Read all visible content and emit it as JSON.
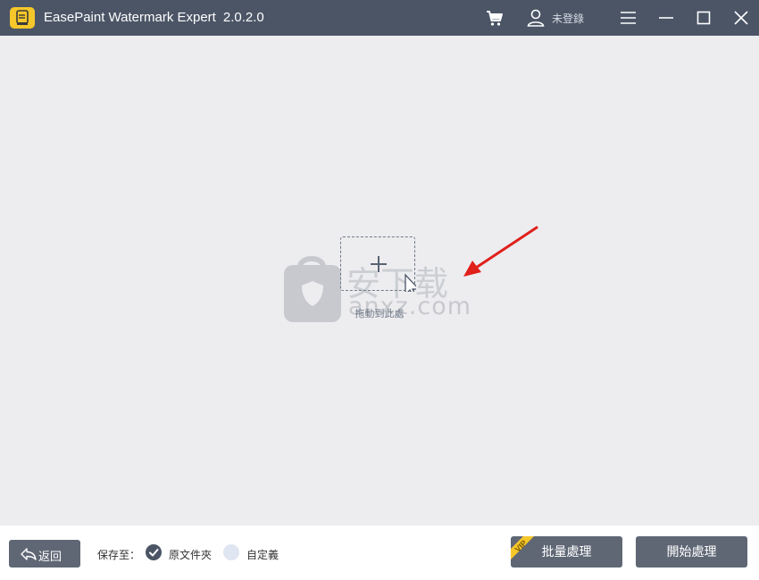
{
  "window": {
    "title": "EasePaint Watermark Expert",
    "version": "2.0.2.0",
    "login_label": "未登錄",
    "icons": [
      "cart-icon",
      "user-icon",
      "menu-icon",
      "minimize-icon",
      "maximize-icon",
      "close-icon"
    ]
  },
  "workspace": {
    "drop_label": "拖動到此處",
    "watermark": {
      "cn": "安下载",
      "en": "anxz.com"
    }
  },
  "bottombar": {
    "back_label": "返回",
    "save_to_label": "保存至：",
    "options": [
      {
        "label": "原文件夾",
        "selected": true
      },
      {
        "label": "自定義",
        "selected": false
      }
    ],
    "batch_label": "批量處理",
    "vip_label": "VIP",
    "start_label": "開始處理"
  },
  "colors": {
    "titlebar": "#4b5566",
    "background": "#ededf0",
    "button": "#5f6775",
    "logo": "#f6c72a",
    "arrow": "#e0201b"
  }
}
